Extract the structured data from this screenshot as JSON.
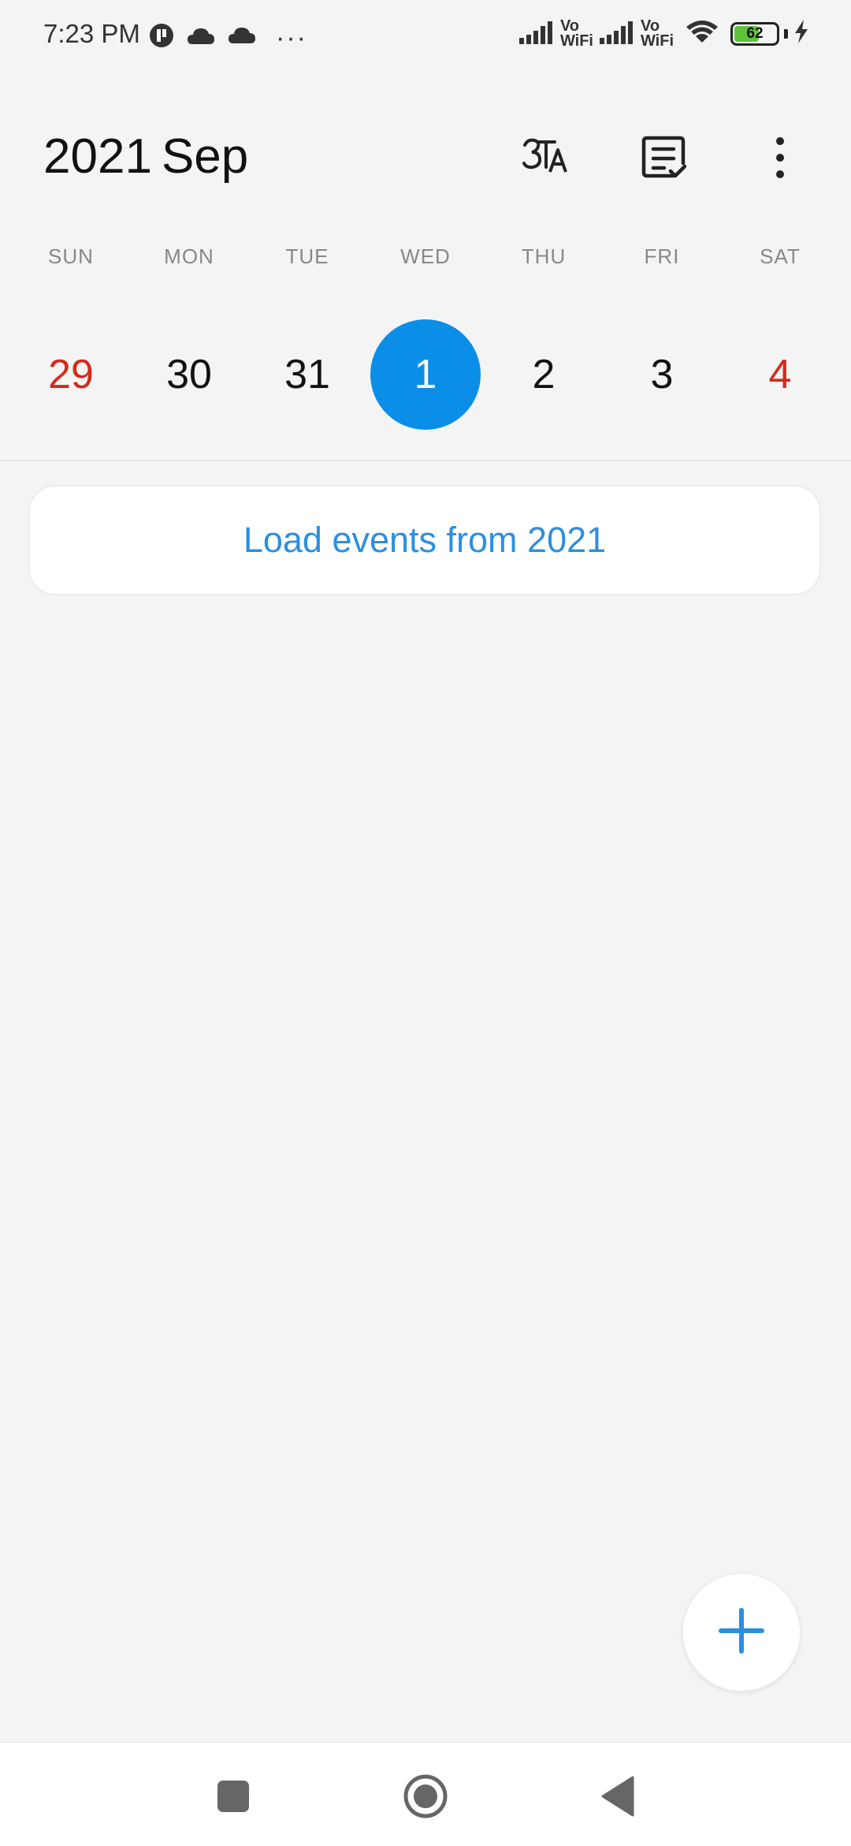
{
  "status_bar": {
    "time": "7:23 PM",
    "left_icons": [
      "app-icon",
      "cloud-icon",
      "cloud-icon",
      "more-dots-icon"
    ],
    "more_dots": "···",
    "vowifi_top": "Vo",
    "vowifi_bottom": "WiFi",
    "battery_level": "62",
    "battery_fraction": 0.62,
    "battery_color": "#5dc43a"
  },
  "header": {
    "year": "2021",
    "month": "Sep",
    "icons": [
      "transliteration-icon",
      "task-list-icon",
      "more-vertical-icon"
    ]
  },
  "week": {
    "weekdays": [
      "SUN",
      "MON",
      "TUE",
      "WED",
      "THU",
      "FRI",
      "SAT"
    ],
    "dates": [
      "29",
      "30",
      "31",
      "1",
      "2",
      "3",
      "4"
    ],
    "selected_index": 3,
    "weekend_color": "#d22b1b",
    "selected_color": "#0a8ee8"
  },
  "load_events_label": "Load events from 2021",
  "fab": {
    "icon": "plus-icon",
    "color": "#2b8fe0"
  },
  "nav_bar": {
    "icons": [
      "recents-square-icon",
      "home-circle-icon",
      "back-triangle-icon"
    ]
  }
}
